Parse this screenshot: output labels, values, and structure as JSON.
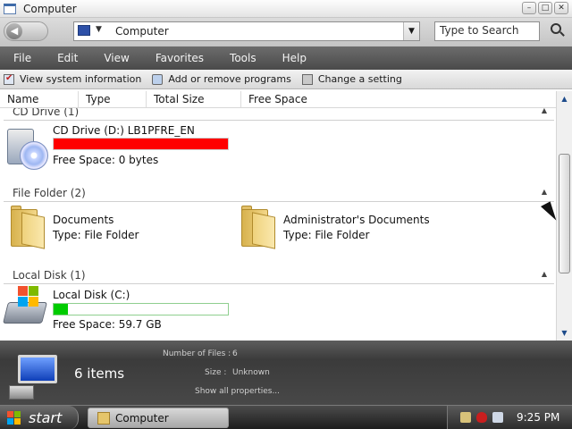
{
  "window": {
    "title": "Computer"
  },
  "address": {
    "path": "Computer",
    "search_placeholder": "Type to Search"
  },
  "menu": [
    "File",
    "Edit",
    "View",
    "Favorites",
    "Tools",
    "Help"
  ],
  "commands": [
    "View system information",
    "Add or remove programs",
    "Change a setting"
  ],
  "columns": [
    "Name",
    "Type",
    "Total Size",
    "Free Space"
  ],
  "groups": {
    "cd": {
      "label": "CD Drive (1)",
      "item": {
        "title": "CD Drive (D:) LB1PFRE_EN",
        "free": "Free Space: 0 bytes",
        "used_fraction": 1.0,
        "bar_color": "#ff0000"
      }
    },
    "folders": {
      "label": "File Folder (2)",
      "items": [
        {
          "title": "Documents",
          "type": "Type: File Folder"
        },
        {
          "title": "Administrator's Documents",
          "type": "Type: File Folder"
        }
      ]
    },
    "disk": {
      "label": "Local Disk (1)",
      "item": {
        "title": "Local Disk (C:)",
        "free": "Free Space: 59.7 GB",
        "used_fraction": 0.08,
        "bar_color": "#00cc00"
      }
    }
  },
  "details": {
    "count": "6 items",
    "files_label": "Number of Files :",
    "files_value": "6",
    "size_label": "Size :",
    "size_value": "Unknown",
    "show_all": "Show all properties..."
  },
  "taskbar": {
    "start": "start",
    "task": "Computer",
    "time": "9:25 PM"
  }
}
